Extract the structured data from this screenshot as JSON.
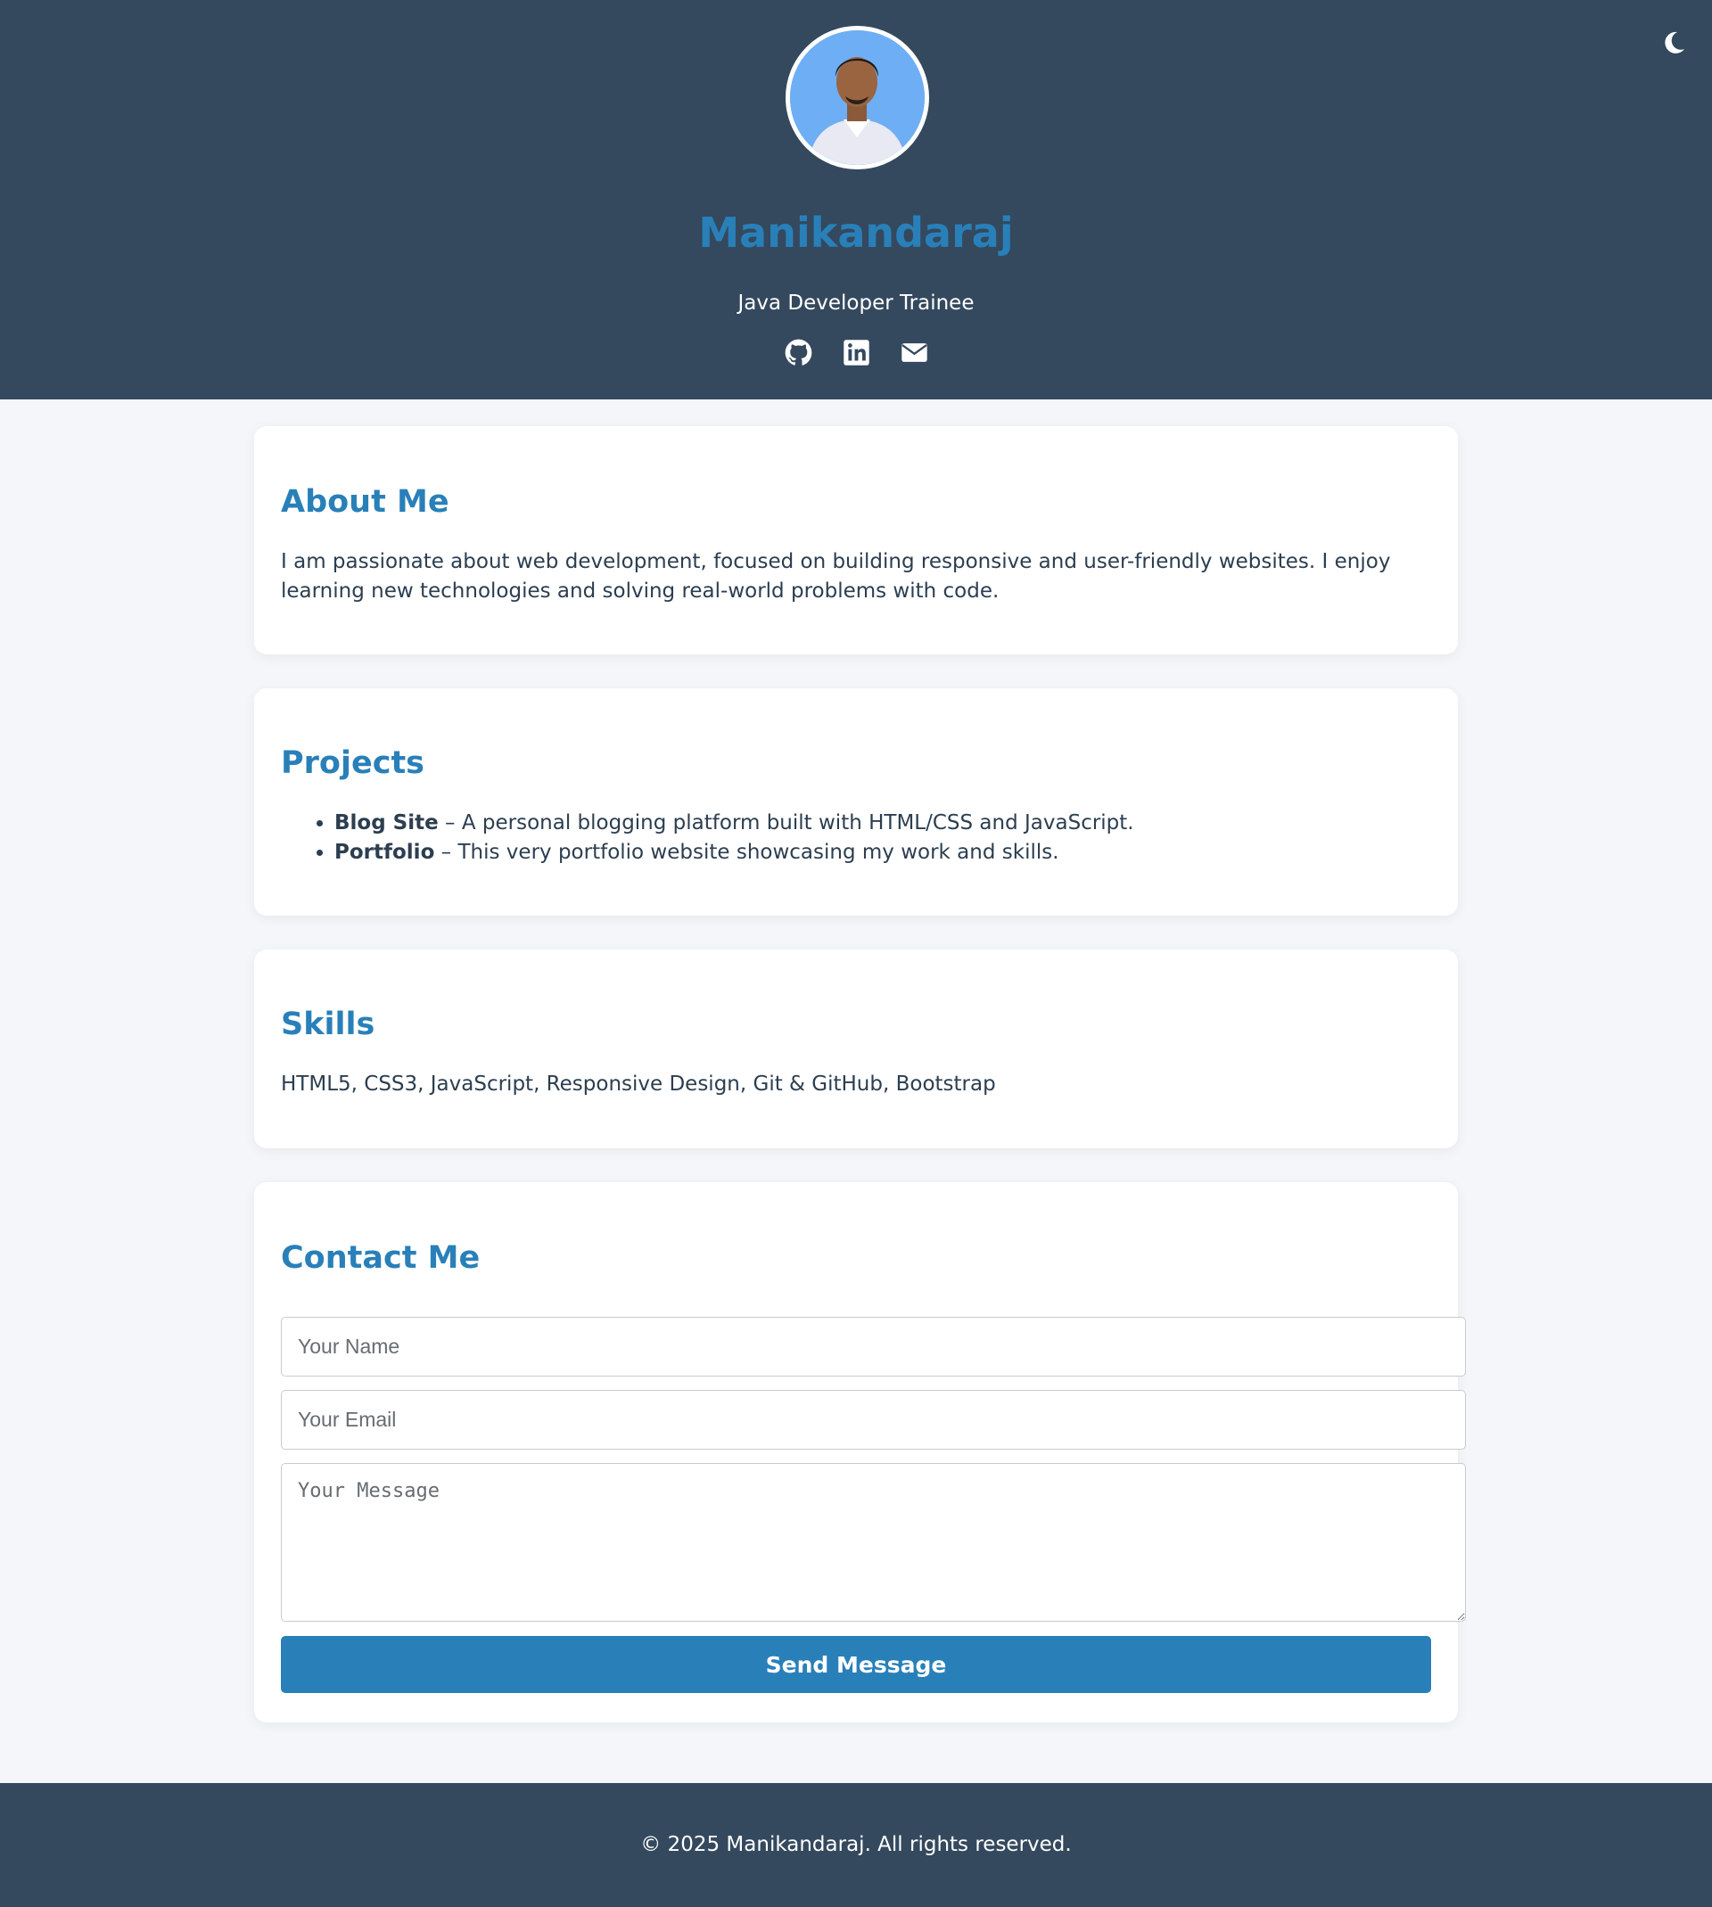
{
  "header": {
    "name": "Manikandaraj",
    "role": "Java Developer Trainee",
    "theme_icon": "moon-icon",
    "social": [
      {
        "icon": "github-icon"
      },
      {
        "icon": "linkedin-icon"
      },
      {
        "icon": "envelope-icon"
      }
    ]
  },
  "about": {
    "title": "About Me",
    "text": "I am passionate about web development, focused on building responsive and user-friendly websites. I enjoy learning new technologies and solving real-world problems with code."
  },
  "projects": {
    "title": "Projects",
    "items": [
      {
        "name": "Blog Site",
        "desc": " – A personal blogging platform built with HTML/CSS and JavaScript."
      },
      {
        "name": "Portfolio",
        "desc": " – This very portfolio website showcasing my work and skills."
      }
    ]
  },
  "skills": {
    "title": "Skills",
    "text": "HTML5, CSS3, JavaScript, Responsive Design, Git & GitHub, Bootstrap"
  },
  "contact": {
    "title": "Contact Me",
    "name_placeholder": "Your Name",
    "email_placeholder": "Your Email",
    "message_placeholder": "Your Message",
    "send_label": "Send Message"
  },
  "footer": {
    "text": "© 2025 Manikandaraj. All rights reserved."
  },
  "colors": {
    "header_bg": "#34495e",
    "accent": "#2980b9",
    "page_bg": "#f4f6f9",
    "avatar_bg": "#6eaef5"
  }
}
